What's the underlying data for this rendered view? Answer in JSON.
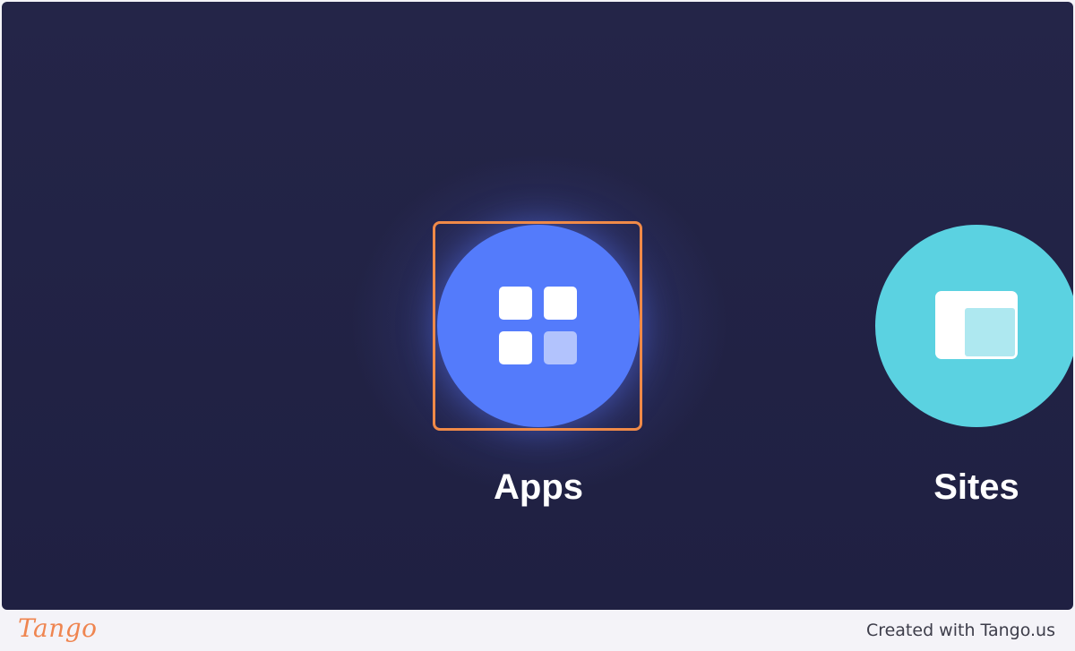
{
  "apps_tile": {
    "label": "Apps",
    "icon": "grid-four-squares-icon",
    "color": "#547bfb",
    "highlighted": true,
    "highlight_color": "#f08a48"
  },
  "sites_tile": {
    "label": "Sites",
    "icon": "website-layout-icon",
    "color": "#5bd2e1"
  },
  "footer": {
    "logo_text": "Tango",
    "credit": "Created with Tango.us",
    "logo_color": "#ef8550"
  }
}
